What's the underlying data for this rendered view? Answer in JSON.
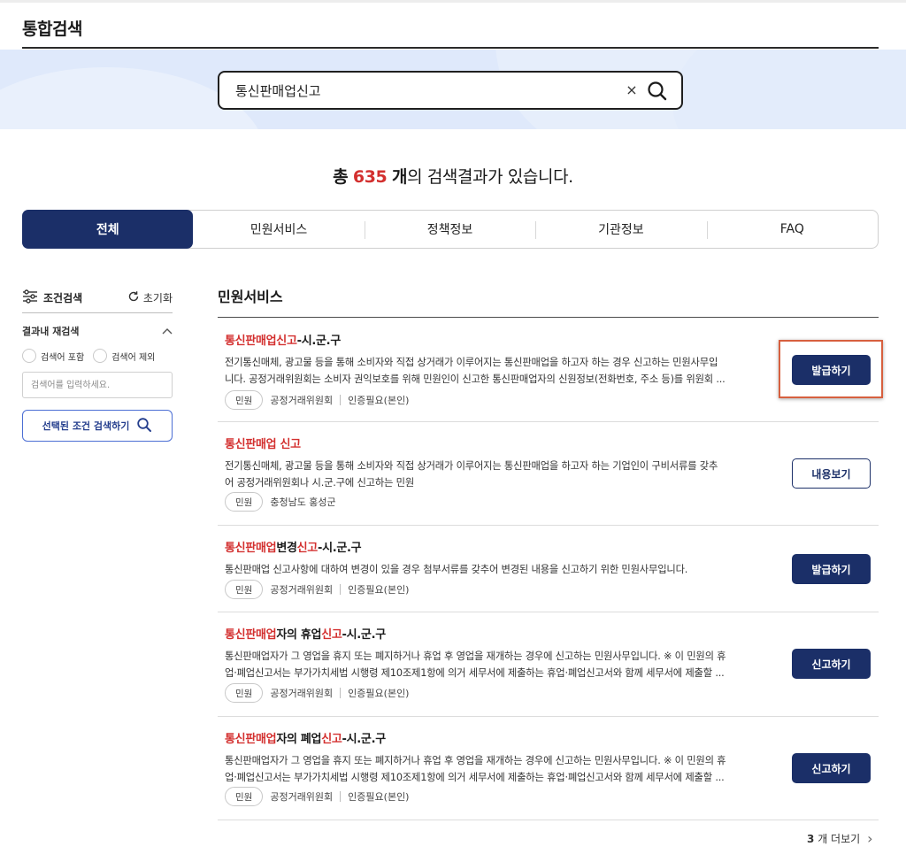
{
  "page": {
    "title": "통합검색"
  },
  "search": {
    "value": "통신판매업신고",
    "clear_glyph": "×",
    "icon": "search-icon"
  },
  "summary": {
    "prefix": "총",
    "count": "635",
    "unit": "개",
    "suffix": "의 검색결과가 있습니다."
  },
  "tabs": [
    {
      "label": "전체",
      "active": true
    },
    {
      "label": "민원서비스",
      "active": false
    },
    {
      "label": "정책정보",
      "active": false
    },
    {
      "label": "기관정보",
      "active": false
    },
    {
      "label": "FAQ",
      "active": false
    }
  ],
  "sidebar": {
    "title": "조건검색",
    "reset_label": "초기화",
    "refine_title": "결과내 재검색",
    "include_label": "검색어 포함",
    "exclude_label": "검색어 제외",
    "input_placeholder": "검색어를 입력하세요.",
    "apply_label": "선택된 조건 검색하기"
  },
  "section": {
    "title": "민원서비스"
  },
  "results": [
    {
      "title_hl": "통신판매업신고",
      "title_rest": "-시.군.구",
      "desc1": "전기통신매체, 광고물 등을 통해 소비자와 직접 상거래가 이루어지는 통신판매업을 하고자 하는 경우 신고하는 민원사무입",
      "desc2": "니다. 공정거래위원회는 소비자 권익보호를 위해 민원인이 신고한 통신판매업자의 신원정보(전화번호, 주소 등)를 위원회 ...",
      "badge": "민원",
      "agency": "공정거래위원회",
      "auth": "인증필요(본인)",
      "button": "발급하기"
    },
    {
      "title_hl": "통신판매업 신고",
      "title_rest": "",
      "desc1": "전기통신매체, 광고물 등을 통해 소비자와 직접 상거래가 이루어지는 통신판매업을 하고자 하는 기업인이 구비서류를 갖추",
      "desc2": "어 공정거래위원회나 시.군.구에 신고하는 민원",
      "badge": "민원",
      "agency": "충청남도 홍성군",
      "auth": "",
      "button": "내용보기"
    },
    {
      "title_hl": "통신판매업",
      "title_mid": "변경",
      "title_hl2": "신고",
      "title_rest": "-시.군.구",
      "desc1": "통신판매업 신고사항에 대하여 변경이 있을 경우 첨부서류를 갖추어 변경된 내용을 신고하기 위한 민원사무입니다.",
      "badge": "민원",
      "agency": "공정거래위원회",
      "auth": "인증필요(본인)",
      "button": "발급하기"
    },
    {
      "title_hl": "통신판매업",
      "title_mid": "자의 휴업",
      "title_hl2": "신고",
      "title_rest": "-시.군.구",
      "desc1": "통신판매업자가 그 영업을 휴지 또는 폐지하거나 휴업 후 영업을 재개하는 경우에 신고하는 민원사무입니다. ※ 이 민원의 휴",
      "desc2": "업·폐업신고서는 부가가치세법 시행령 제10조제1항에 의거 세무서에 제출하는 휴업·폐업신고서와 함께 세무서에 제출할 ...",
      "badge": "민원",
      "agency": "공정거래위원회",
      "auth": "인증필요(본인)",
      "button": "신고하기"
    },
    {
      "title_hl": "통신판매업",
      "title_mid": "자의 폐업",
      "title_hl2": "신고",
      "title_rest": "-시.군.구",
      "desc1": "통신판매업자가 그 영업을 휴지 또는 폐지하거나 휴업 후 영업을 재개하는 경우에 신고하는 민원사무입니다. ※ 이 민원의 휴",
      "desc2": "업·폐업신고서는 부가가치세법 시행령 제10조제1항에 의거 세무서에 제출하는 휴업·폐업신고서와 함께 세무서에 제출할 ...",
      "badge": "민원",
      "agency": "공정거래위원회",
      "auth": "인증필요(본인)",
      "button": "신고하기"
    }
  ],
  "more": {
    "count": "3",
    "label": "개 더보기",
    "chevron": "›"
  },
  "colors": {
    "navy": "#1b2f68",
    "highlight_red": "#d3302f",
    "hero_bg": "#dfe9fb",
    "annotation_box": "#d7603f"
  }
}
